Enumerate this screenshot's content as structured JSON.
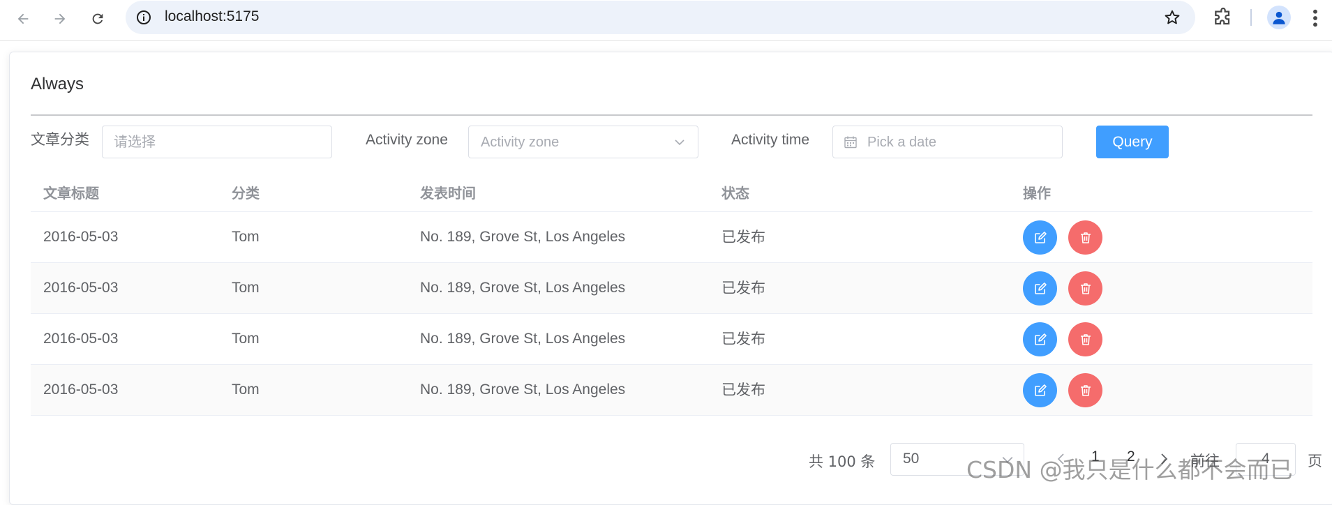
{
  "browser": {
    "url": "localhost:5175"
  },
  "card": {
    "title": "Always"
  },
  "filters": {
    "category_label": "文章分类",
    "category_placeholder": "请选择",
    "zone_label": "Activity zone",
    "zone_placeholder": "Activity zone",
    "time_label": "Activity time",
    "time_placeholder": "Pick a date",
    "query_label": "Query"
  },
  "table": {
    "columns": [
      "文章标题",
      "分类",
      "发表时间",
      "状态",
      "操作"
    ],
    "rows": [
      {
        "title": "2016-05-03",
        "category": "Tom",
        "published": "No. 189, Grove St, Los Angeles",
        "status": "已发布"
      },
      {
        "title": "2016-05-03",
        "category": "Tom",
        "published": "No. 189, Grove St, Los Angeles",
        "status": "已发布"
      },
      {
        "title": "2016-05-03",
        "category": "Tom",
        "published": "No. 189, Grove St, Los Angeles",
        "status": "已发布"
      },
      {
        "title": "2016-05-03",
        "category": "Tom",
        "published": "No. 189, Grove St, Los Angeles",
        "status": "已发布"
      }
    ]
  },
  "pagination": {
    "total": "共 100 条",
    "page_size": "50",
    "pages": [
      "1",
      "2"
    ],
    "goto_label": "前往",
    "goto_value": "4",
    "page_suffix": "页"
  },
  "watermark": "CSDN @我只是什么都不会而已",
  "colors": {
    "primary": "#409eff",
    "danger": "#f56c6c"
  }
}
